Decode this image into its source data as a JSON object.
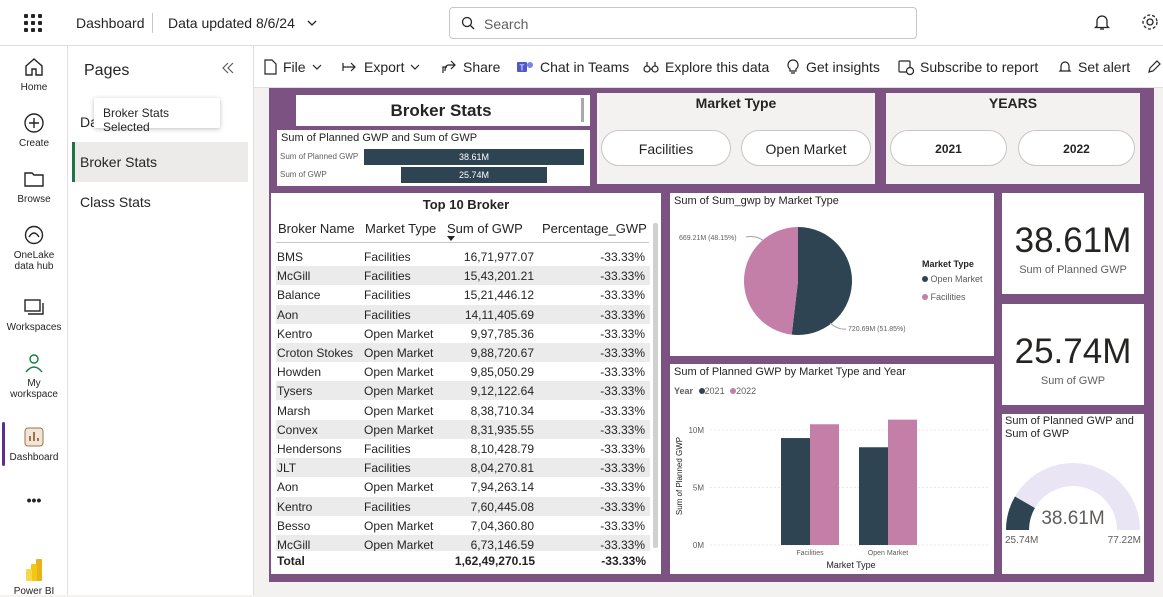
{
  "topbar": {
    "app": "Dashboard",
    "data_updated": "Data updated 8/6/24",
    "search_placeholder": "Search"
  },
  "nav": [
    {
      "label": "Home",
      "icon": "home-icon"
    },
    {
      "label": "Create",
      "icon": "plus-circle-icon"
    },
    {
      "label": "Browse",
      "icon": "folder-icon"
    },
    {
      "label1": "OneLake",
      "label2": "data hub",
      "icon": "onelake-icon"
    },
    {
      "label": "Workspaces",
      "icon": "workspaces-icon"
    },
    {
      "label1": "My",
      "label2": "workspace",
      "icon": "person-icon"
    },
    {
      "label": "Dashboard",
      "icon": "dashboard-icon"
    },
    {
      "label": "•••",
      "icon": "more-icon"
    },
    {
      "label": "Power BI",
      "icon": "powerbi-logo"
    }
  ],
  "pages": {
    "title": "Pages",
    "items": [
      "Da",
      "Broker Stats",
      "Class Stats"
    ],
    "tooltip": "Broker Stats Selected"
  },
  "toolbar": {
    "file": "File",
    "export": "Export",
    "share": "Share",
    "chat": "Chat in Teams",
    "explore": "Explore this data",
    "insights": "Get insights",
    "subscribe": "Subscribe to report",
    "alert": "Set alert"
  },
  "report": {
    "title": "Broker Stats",
    "bar_title": "Sum of Planned GWP and Sum of GWP",
    "bar_rows": [
      {
        "label": "Sum of Planned GWP",
        "value": "38.61M",
        "num": 38.61
      },
      {
        "label": "Sum of GWP",
        "value": "25.74M",
        "num": 25.74
      }
    ],
    "market_type": {
      "title": "Market Type",
      "options": [
        "Facilities",
        "Open Market"
      ]
    },
    "years": {
      "title": "YEARS",
      "options": [
        "2021",
        "2022"
      ]
    },
    "table": {
      "title": "Top 10 Broker",
      "headers": [
        "Broker Name",
        "Market Type",
        "Sum of GWP",
        "Percentage_GWP"
      ],
      "rows": [
        [
          "BMS",
          "Facilities",
          "16,71,977.07",
          "-33.33%"
        ],
        [
          "McGill",
          "Facilities",
          "15,43,201.21",
          "-33.33%"
        ],
        [
          "Balance",
          "Facilities",
          "15,21,446.12",
          "-33.33%"
        ],
        [
          "Aon",
          "Facilities",
          "14,11,405.69",
          "-33.33%"
        ],
        [
          "Kentro",
          "Open Market",
          "9,97,785.36",
          "-33.33%"
        ],
        [
          "Croton Stokes",
          "Open Market",
          "9,88,720.67",
          "-33.33%"
        ],
        [
          "Howden",
          "Open Market",
          "9,85,050.29",
          "-33.33%"
        ],
        [
          "Tysers",
          "Open Market",
          "9,12,122.64",
          "-33.33%"
        ],
        [
          "Marsh",
          "Open Market",
          "8,38,710.34",
          "-33.33%"
        ],
        [
          "Convex",
          "Open Market",
          "8,31,935.55",
          "-33.33%"
        ],
        [
          "Hendersons",
          "Facilities",
          "8,10,428.79",
          "-33.33%"
        ],
        [
          "JLT",
          "Facilities",
          "8,04,270.81",
          "-33.33%"
        ],
        [
          "Aon",
          "Open Market",
          "7,94,263.14",
          "-33.33%"
        ],
        [
          "Kentro",
          "Facilities",
          "7,60,445.08",
          "-33.33%"
        ],
        [
          "Besso",
          "Open Market",
          "7,04,360.80",
          "-33.33%"
        ],
        [
          "McGill",
          "Open Market",
          "6,73,146.59",
          "-33.33%"
        ]
      ],
      "total": [
        "Total",
        "1,62,49,270.15",
        "-33.33%"
      ]
    },
    "pie": {
      "title": "Sum of Sum_gwp by Market Type",
      "legend_title": "Market Type",
      "slices": [
        {
          "name": "Open Market",
          "value": 720.69,
          "label": "720.69M (51.85%)",
          "color": "#2e4453"
        },
        {
          "name": "Facilities",
          "value": 669.21,
          "label": "669.21M (48.15%)",
          "color": "#c47fa8"
        }
      ]
    },
    "kpi1": {
      "value": "38.61M",
      "label": "Sum of Planned GWP"
    },
    "kpi2": {
      "value": "25.74M",
      "label": "Sum of GWP"
    },
    "gauge": {
      "title": "Sum of Planned GWP and Sum of GWP",
      "value": "38.61M",
      "min": "25.74M",
      "max": "77.22M",
      "num": 38.61,
      "min_num": 0,
      "max_num": 77.22,
      "target_num": 25.74
    }
  },
  "chart_data": {
    "type": "bar",
    "title": "Sum of Planned GWP by Market Type and Year",
    "legend_title": "Year",
    "categories": [
      "Facilities",
      "Open Market"
    ],
    "series": [
      {
        "name": "2021",
        "values": [
          9.3,
          8.5
        ],
        "color": "#2e4453"
      },
      {
        "name": "2022",
        "values": [
          10.5,
          10.9
        ],
        "color": "#c47fa8"
      }
    ],
    "ylabel": "Sum of Planned GWP",
    "xlabel": "Market Type",
    "yticks": [
      "10M",
      "5M",
      "0M"
    ],
    "ylim": [
      0,
      12
    ]
  }
}
